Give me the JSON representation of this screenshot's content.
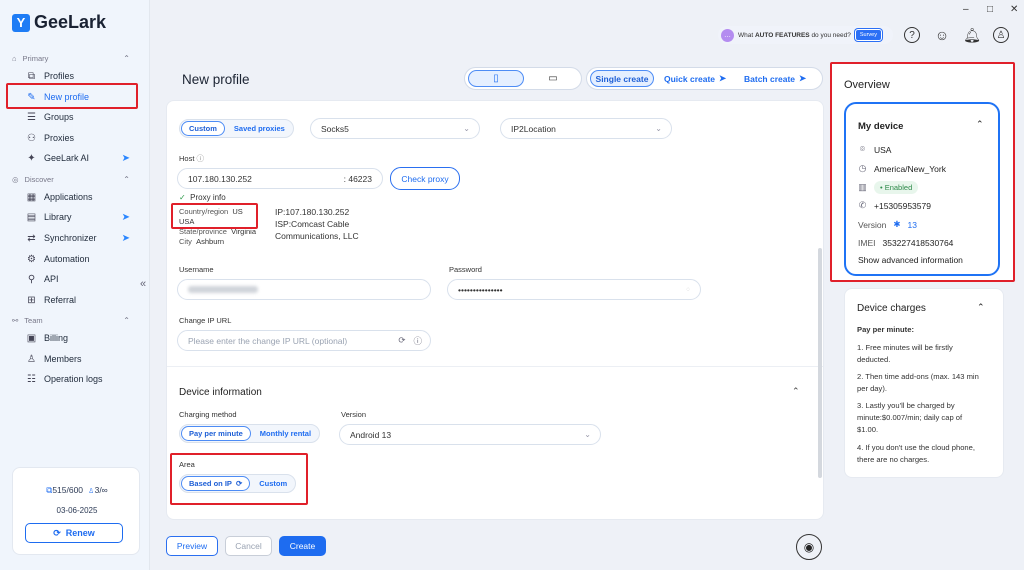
{
  "app": {
    "logo": "GeeLark"
  },
  "sidebar": {
    "sections": {
      "primary": "Primary",
      "discover": "Discover",
      "team": "Team"
    },
    "items": {
      "profiles": "Profiles",
      "new_profile": "New profile",
      "groups": "Groups",
      "proxies": "Proxies",
      "geelark_ai": "GeeLark AI",
      "applications": "Applications",
      "library": "Library",
      "synchronizer": "Synchronizer",
      "automation": "Automation",
      "api": "API",
      "referral": "Referral",
      "billing": "Billing",
      "members": "Members",
      "operation_logs": "Operation logs"
    },
    "quota": {
      "profiles": "515/600",
      "members": "3/∞",
      "date": "03-06-2025",
      "renew": "Renew"
    }
  },
  "topbar": {
    "banner_pre": "What ",
    "banner_bold": "AUTO FEATURES",
    "banner_post": " do you need?",
    "survey": "Survey",
    "win_min": "–",
    "win_max": "□",
    "win_close": "✕"
  },
  "page": {
    "title": "New profile",
    "modes": {
      "single": "Single create",
      "quick": "Quick create",
      "batch": "Batch create"
    }
  },
  "proxy": {
    "tab_custom": "Custom",
    "tab_saved": "Saved proxies",
    "protocol": "Socks5",
    "lookup": "IP2Location",
    "host_label": "Host",
    "host_value": "107.180.130.252",
    "port_value": ": 46223",
    "check_btn": "Check proxy",
    "info_label": "Proxy info",
    "country_label": "Country/region",
    "country_value": "US",
    "country_name": "USA",
    "state_label": "State/province",
    "state_value": "Virginia",
    "city_label": "City",
    "city_value": "Ashburn",
    "ip_line": "IP:107.180.130.252",
    "isp_line1": "ISP:Comcast Cable",
    "isp_line2": "Communications, LLC",
    "username_label": "Username",
    "password_label": "Password",
    "password_value": "•••••••••••••••",
    "change_ip_label": "Change IP URL",
    "change_ip_placeholder": "Please enter the change IP URL (optional)"
  },
  "device_info": {
    "heading": "Device information",
    "charging_label": "Charging method",
    "pay_per_minute": "Pay per minute",
    "monthly_rental": "Monthly rental",
    "version_label": "Version",
    "version_value": "Android 13",
    "area_label": "Area",
    "area_based_on_ip": "Based on IP",
    "area_custom": "Custom"
  },
  "footer": {
    "preview": "Preview",
    "cancel": "Cancel",
    "create": "Create"
  },
  "overview": {
    "title": "Overview",
    "my_device": "My device",
    "country": "USA",
    "timezone": "America/New_York",
    "status": "• Enabled",
    "phone": "+15305953579",
    "version_label": "Version",
    "version_num": "13",
    "imei_label": "IMEI",
    "imei": "353227418530764",
    "advanced": "Show advanced information"
  },
  "charges": {
    "title": "Device charges",
    "heading": "Pay per minute:",
    "p1": "1. Free minutes will be firstly deducted.",
    "p2": "2. Then time add-ons (max. 143 min per day).",
    "p3": "3. Lastly you'll be charged by minute:$0.007/min; daily cap of $1.00.",
    "p4": "4. If you don't use the cloud phone, there are no charges."
  },
  "colors": {
    "accent": "#1e6cf0",
    "highlight": "#e0202a",
    "enabled": "#2e8a4a"
  }
}
